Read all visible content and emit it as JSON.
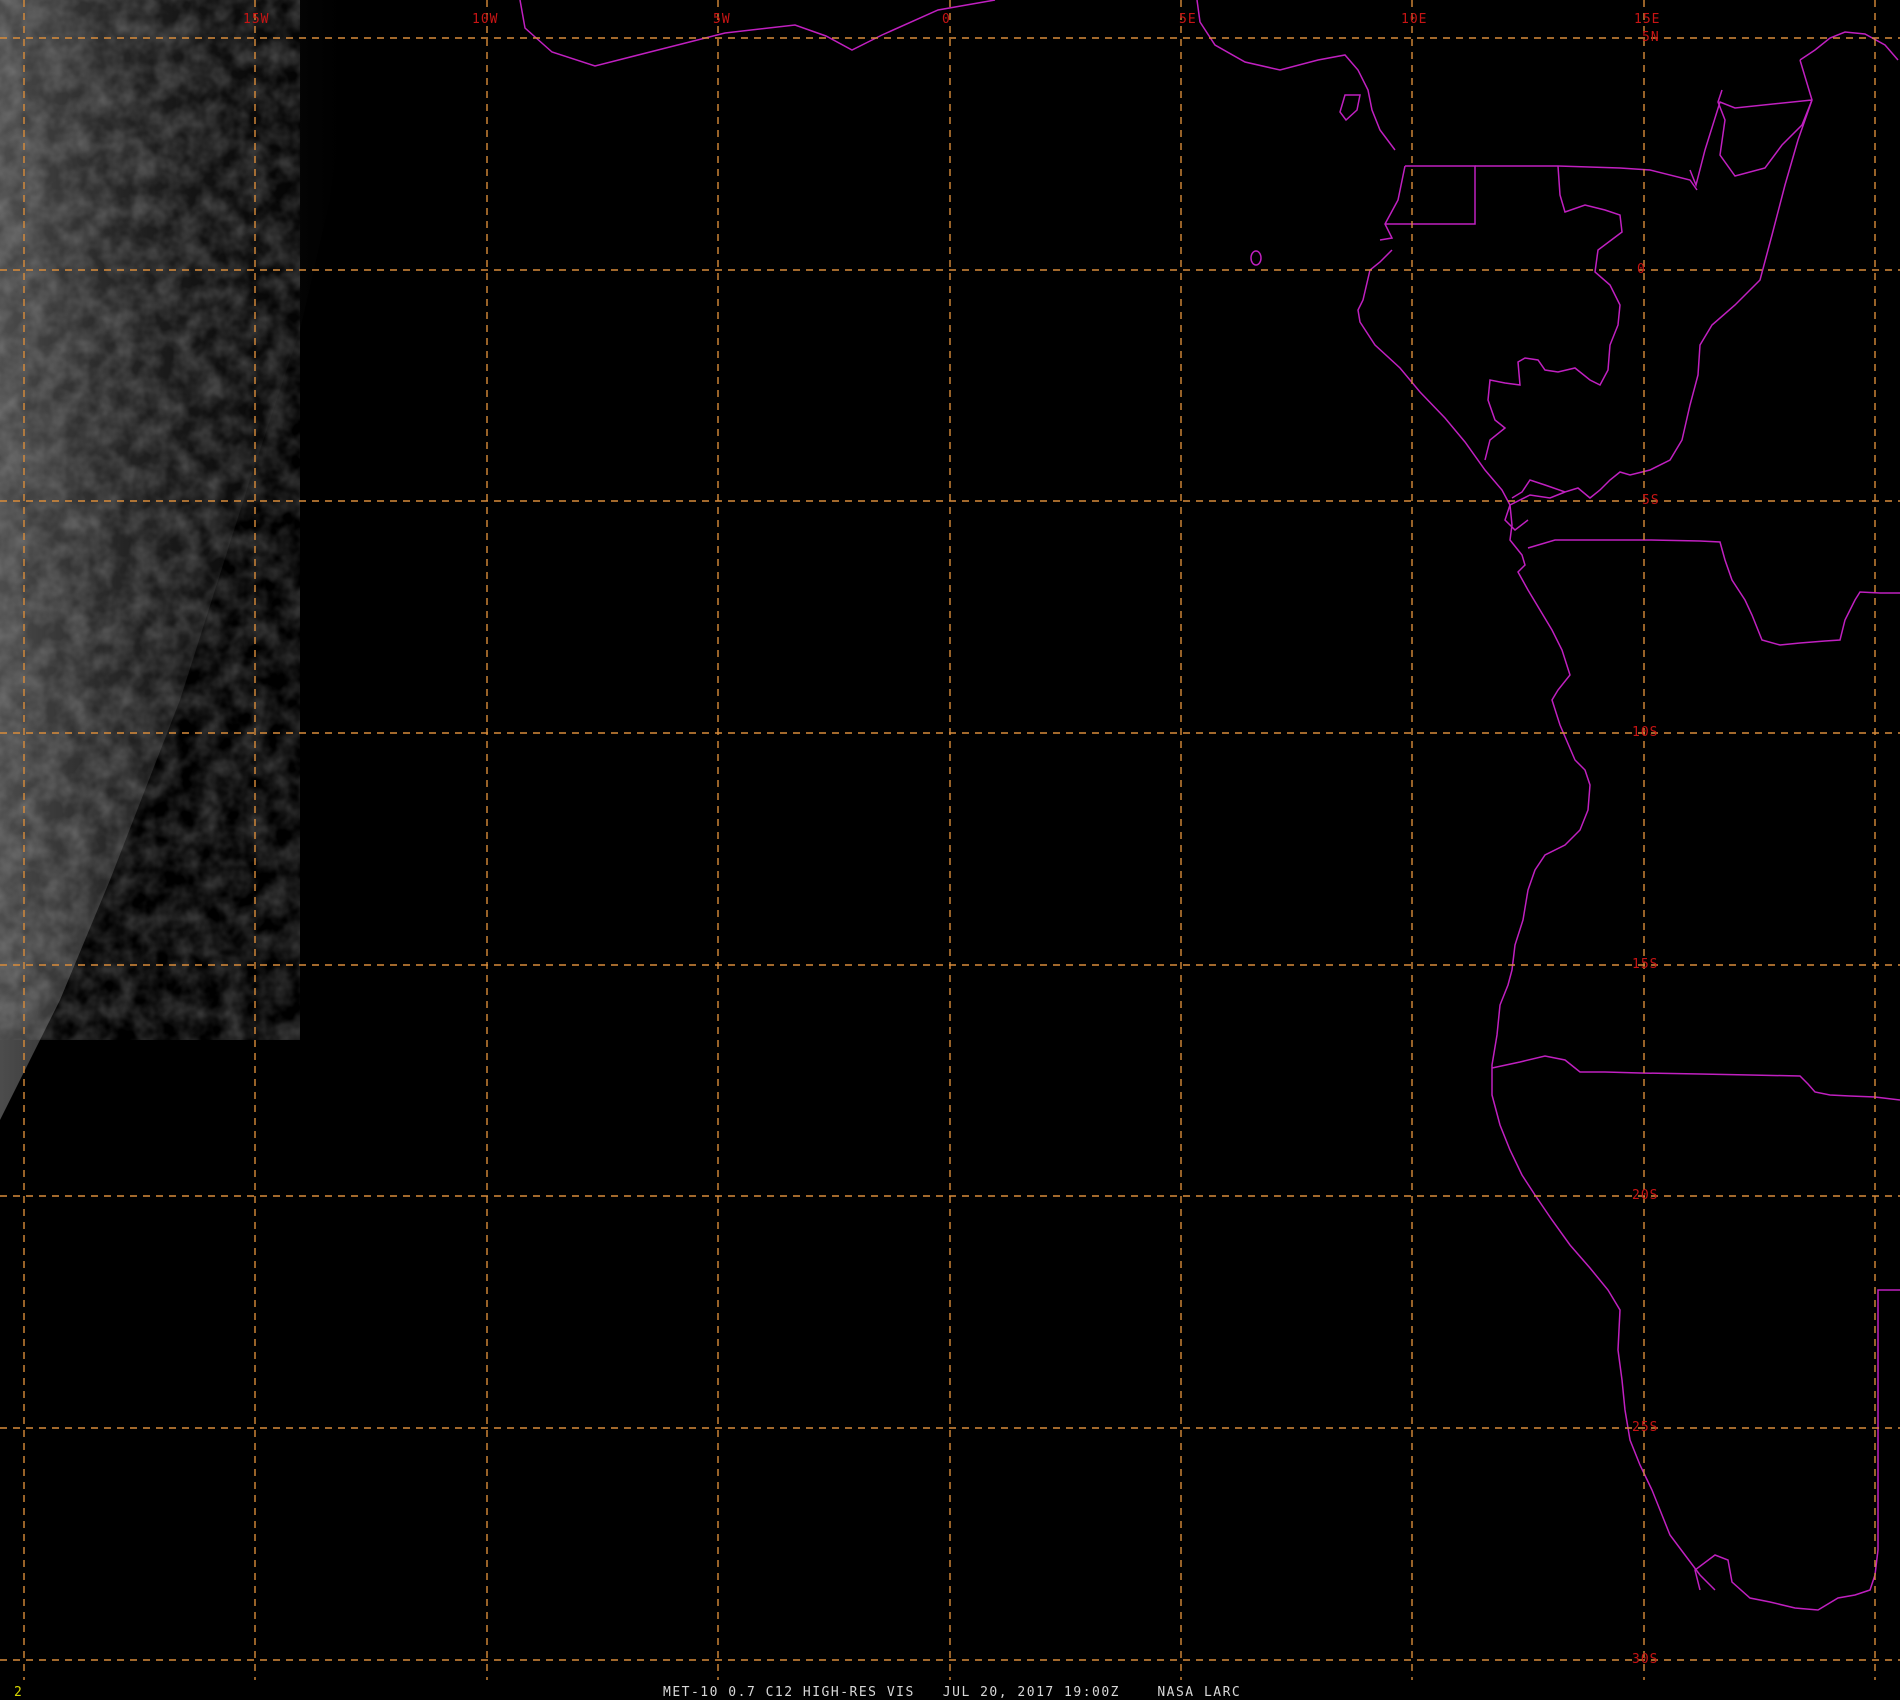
{
  "colors": {
    "background": "#000000",
    "grid_line": "#d98c3a",
    "grid_label": "#c81414",
    "boundary": "#c020c0",
    "caption": "#d8d8d8",
    "frame_number": "#d8d800"
  },
  "grid": {
    "line_style": "dashed",
    "longitude_labels": [
      "15W",
      "10W",
      "5W",
      "0",
      "5E",
      "10E",
      "15E"
    ],
    "latitude_labels": [
      "5N",
      "0",
      "5S",
      "10S",
      "15S",
      "20S",
      "25S",
      "30S"
    ]
  },
  "caption": {
    "text": "MET-10 0.7 C12 HIGH-RES VIS   JUL 20, 2017 19:00Z    NASA LARC"
  },
  "frame_number": "2",
  "map_layers": [
    "coastline",
    "country-borders",
    "lat-lon-grid",
    "satellite-visible-imagery"
  ]
}
